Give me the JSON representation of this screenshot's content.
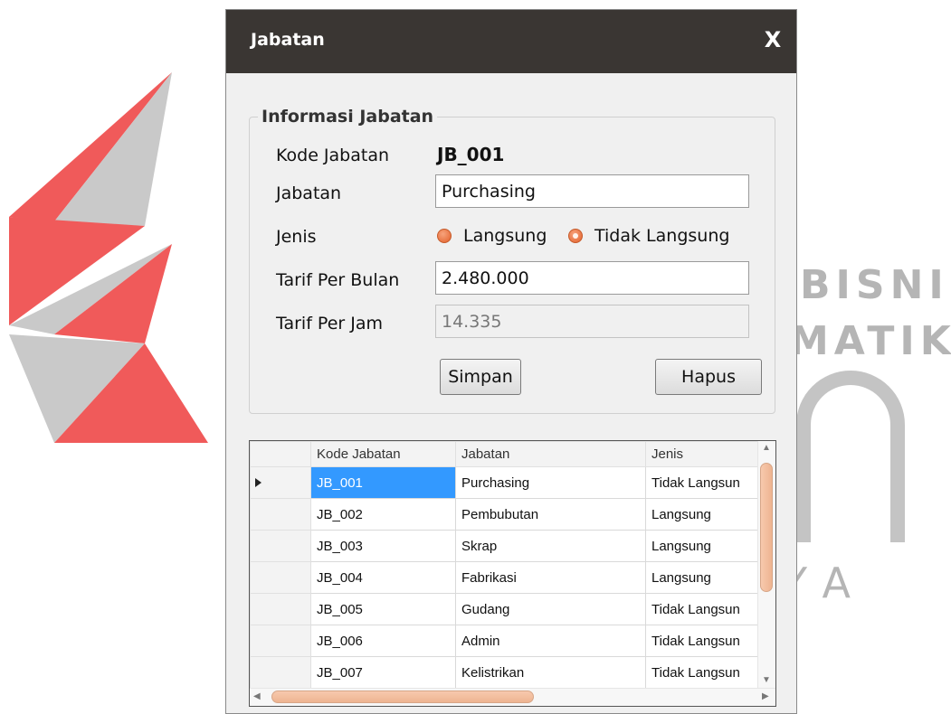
{
  "watermark": {
    "line1": "BISNIS",
    "line2": "MATIKA",
    "line3": "YA"
  },
  "window": {
    "title": "Jabatan",
    "close_label": "X"
  },
  "form": {
    "group_title": "Informasi Jabatan",
    "kode_label": "Kode Jabatan",
    "kode_value": "JB_001",
    "jabatan_label": "Jabatan",
    "jabatan_value": "Purchasing",
    "jenis_label": "Jenis",
    "jenis_options": [
      {
        "label": "Langsung",
        "checked": false
      },
      {
        "label": "Tidak Langsung",
        "checked": true
      }
    ],
    "tarif_bulan_label": "Tarif Per Bulan",
    "tarif_bulan_value": "2.480.000",
    "tarif_jam_label": "Tarif Per Jam",
    "tarif_jam_value": "14.335",
    "simpan_label": "Simpan",
    "hapus_label": "Hapus"
  },
  "grid": {
    "columns": [
      "Kode Jabatan",
      "Jabatan",
      "Jenis"
    ],
    "rows": [
      {
        "kode": "JB_001",
        "jabatan": "Purchasing",
        "jenis": "Tidak Langsun"
      },
      {
        "kode": "JB_002",
        "jabatan": "Pembubutan",
        "jenis": "Langsung"
      },
      {
        "kode": "JB_003",
        "jabatan": "Skrap",
        "jenis": "Langsung"
      },
      {
        "kode": "JB_004",
        "jabatan": "Fabrikasi",
        "jenis": "Langsung"
      },
      {
        "kode": "JB_005",
        "jabatan": "Gudang",
        "jenis": "Tidak Langsun"
      },
      {
        "kode": "JB_006",
        "jabatan": "Admin",
        "jenis": "Tidak Langsun"
      },
      {
        "kode": "JB_007",
        "jabatan": "Kelistrikan",
        "jenis": "Tidak Langsun"
      }
    ],
    "selected_row": 0
  }
}
